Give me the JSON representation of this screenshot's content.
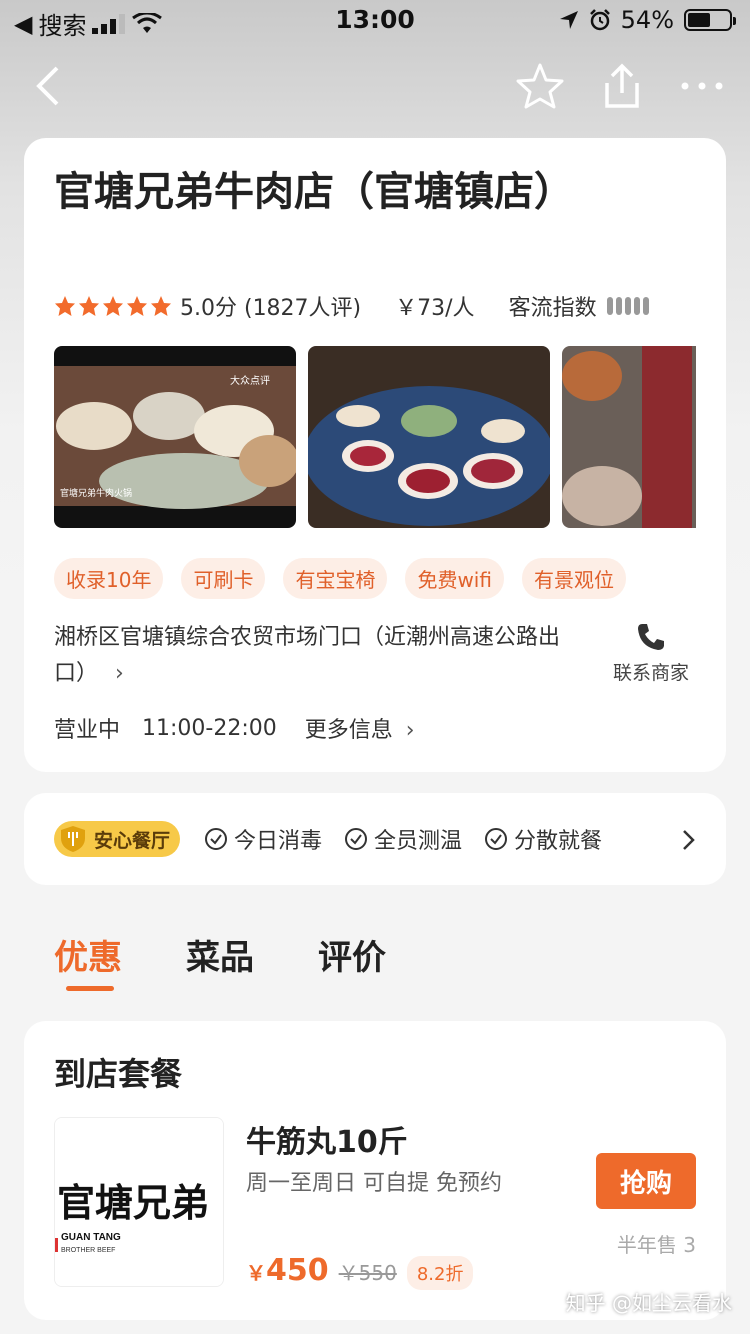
{
  "status_bar": {
    "back_app": "搜索",
    "time": "13:00",
    "battery": "54%",
    "battery_level": 0.54
  },
  "shop": {
    "name": "官塘兄弟牛肉店（官塘镇店）",
    "rating_stars": 5,
    "rating_text": "5.0分 (1827人评)",
    "price_per_person": "￥73/人",
    "traffic_label": "客流指数",
    "photo_caption": "官塘兄弟牛肉火锅",
    "photo_brand": "大众点评",
    "tags": [
      "收录10年",
      "可刷卡",
      "有宝宝椅",
      "免费wifi",
      "有景观位"
    ],
    "address": "湘桥区官塘镇综合农贸市场门口（近潮州高速公路出口）",
    "contact_label": "联系商家",
    "status": "营业中",
    "hours": "11:00-22:00",
    "more_info": "更多信息"
  },
  "safety": {
    "badge": "安心餐厅",
    "items": [
      "今日消毒",
      "全员测温",
      "分散就餐"
    ]
  },
  "tabs": [
    "优惠",
    "菜品",
    "评价"
  ],
  "deal_section": {
    "title": "到店套餐",
    "item": {
      "name": "牛筋丸10斤",
      "desc": "周一至周日  可自提  免预约",
      "price_symbol": "￥",
      "price": "450",
      "original_price": "￥550",
      "discount": "8.2折",
      "buy_label": "抢购",
      "sold": "半年售 3",
      "logo_cn": "官塘兄弟",
      "logo_en": "GUAN TANG",
      "logo_en2": "BROTHER BEEF"
    }
  },
  "watermark": "知乎 @如尘云看水",
  "colors": {
    "accent": "#ee6a2b",
    "gold": "#f7c948"
  }
}
